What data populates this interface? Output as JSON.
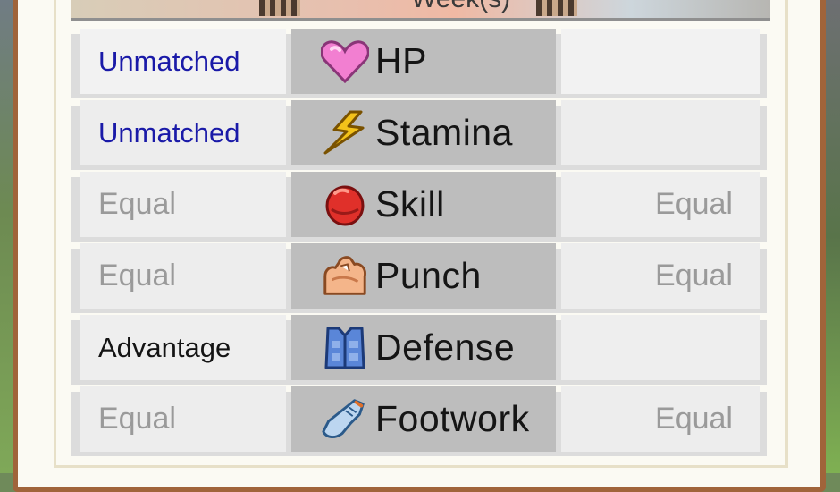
{
  "header": {
    "visible_text": "Week(s)"
  },
  "colors": {
    "unmatched": "#1a1aa8",
    "equal": "#9a9a9a",
    "advantage": "#141414",
    "frame": "#a0643a",
    "cell_light": "#eeeeee",
    "cell_mid": "#bdbdbd"
  },
  "stats": [
    {
      "label": "HP",
      "icon": "heart-icon",
      "left": "Unmatched",
      "left_color": "#1a1aa8",
      "right": ""
    },
    {
      "label": "Stamina",
      "icon": "lightning-icon",
      "left": "Unmatched",
      "left_color": "#1a1aa8",
      "right": ""
    },
    {
      "label": "Skill",
      "icon": "boxing-glove-icon",
      "left": "Equal",
      "left_color": "#9a9a9a",
      "right": "Equal"
    },
    {
      "label": "Punch",
      "icon": "flexed-arm-icon",
      "left": "Equal",
      "left_color": "#9a9a9a",
      "right": "Equal"
    },
    {
      "label": "Defense",
      "icon": "armor-vest-icon",
      "left": "Advantage",
      "left_color": "#141414",
      "right": ""
    },
    {
      "label": "Footwork",
      "icon": "sneaker-icon",
      "left": "Equal",
      "left_color": "#9a9a9a",
      "right": "Equal"
    }
  ]
}
